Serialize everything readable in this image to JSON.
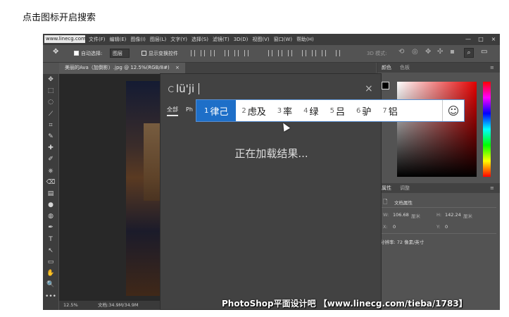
{
  "caption": "点击图标开启搜索",
  "photoshop": {
    "site_logo": "www.linecg.com.cn",
    "menu": [
      "文件(F)",
      "编辑(E)",
      "图像(I)",
      "图层(L)",
      "文字(Y)",
      "选择(S)",
      "滤镜(T)",
      "3D(D)",
      "视图(V)",
      "窗口(W)",
      "帮助(H)"
    ],
    "window_controls": [
      "—",
      "□",
      "×"
    ],
    "options_bar": {
      "auto_select_label": "自动选择:",
      "auto_select_value": "图层",
      "show_transform_label": "显示变换控件",
      "mode_3d_label": "3D 模式:"
    },
    "doc_tab": "美丽的Ava（加倒影）.jpg @ 12.5%(RGB/8#)",
    "doc_tab_close": "×",
    "status": {
      "zoom": "12.5%",
      "doc_size": "文档:34.9M/34.9M"
    },
    "tools": [
      "✥",
      "⬚",
      "◌",
      "⟋",
      "⌗",
      "✎",
      "✚",
      "✐",
      "⎈",
      "⌫",
      "▤",
      "●",
      "◍",
      "✒",
      "T",
      "↖",
      "▭",
      "✋",
      "🔍",
      "•••"
    ],
    "color_panel": {
      "tabs": [
        "颜色",
        "色板"
      ]
    },
    "properties_panel": {
      "tabs": [
        "属性",
        "调整"
      ],
      "doc_props": "文档属性",
      "w_label": "W:",
      "w_value": "106.68",
      "w_unit": "厘米",
      "h_label": "H:",
      "h_value": "142.24",
      "h_unit": "厘米",
      "x_label": "X:",
      "x_value": "0",
      "y_label": "Y:",
      "y_value": "0",
      "resolution": "分辨率: 72 像素/英寸"
    }
  },
  "search_dialog": {
    "query": "lü'ji",
    "close": "×",
    "tabs": [
      "全部",
      "Ph"
    ],
    "loading_text": "正在加载结果..."
  },
  "ime": {
    "candidates": [
      {
        "num": "1",
        "text": "律己"
      },
      {
        "num": "2",
        "text": "虑及"
      },
      {
        "num": "3",
        "text": "率"
      },
      {
        "num": "4",
        "text": "绿"
      },
      {
        "num": "5",
        "text": "吕"
      },
      {
        "num": "6",
        "text": "驴"
      },
      {
        "num": "7",
        "text": "铝"
      }
    ],
    "emoji": "☺"
  },
  "watermark": "PhotoShop平面设计吧 【www.linecg.com/tieba/1783】"
}
